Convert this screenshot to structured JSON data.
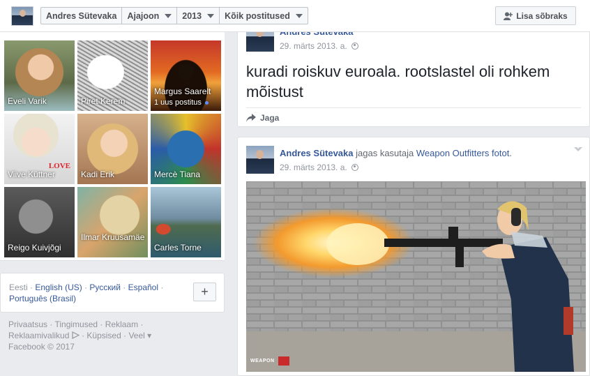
{
  "topbar": {
    "profile_name": "Andres Sütevaka",
    "timeline_label": "Ajajoon",
    "year_label": "2013",
    "filter_label": "Kõik postitused",
    "add_friend_label": "Lisa sõbraks"
  },
  "friends": [
    {
      "name": "Eveli Varik"
    },
    {
      "name": "Piret Kerem"
    },
    {
      "name": "Margus Saarelt",
      "sub": "1 uus postitus"
    },
    {
      "name": "Viive Küttner",
      "badge": "LOVE"
    },
    {
      "name": "Kadi Erik"
    },
    {
      "name": "Mercè Tiana"
    },
    {
      "name": "Reigo Kuivjõgi"
    },
    {
      "name": "Ilmar Kruusamäe"
    },
    {
      "name": "Carles Torne"
    }
  ],
  "languages": {
    "current": "Eesti",
    "others": [
      "English (US)",
      "Русский",
      "Español",
      "Português (Brasil)"
    ]
  },
  "footer": {
    "links": [
      "Privaatsus",
      "Tingimused",
      "Reklaam",
      "Reklaamivalikud",
      "Küpsised",
      "Veel"
    ],
    "copyright": "Facebook © 2017"
  },
  "post1": {
    "author": "Andres Sütevaka",
    "date": "29. märts 2013. a.",
    "text": "kuradi roiskuv euroala. rootslastel oli rohkem mõistust",
    "share_label": "Jaga"
  },
  "post2": {
    "author": "Andres Sütevaka",
    "shared_text": "jagas kasutaja",
    "shared_page": "Weapon Outfitters",
    "shared_object": "fotot",
    "period": ".",
    "date": "29. märts 2013. a.",
    "photo_watermark": "WEAPON"
  },
  "colors": {
    "link": "#365899",
    "background": "#e9ebee",
    "unread_dot": "#5890ff",
    "love_badge": "#e0242b"
  }
}
